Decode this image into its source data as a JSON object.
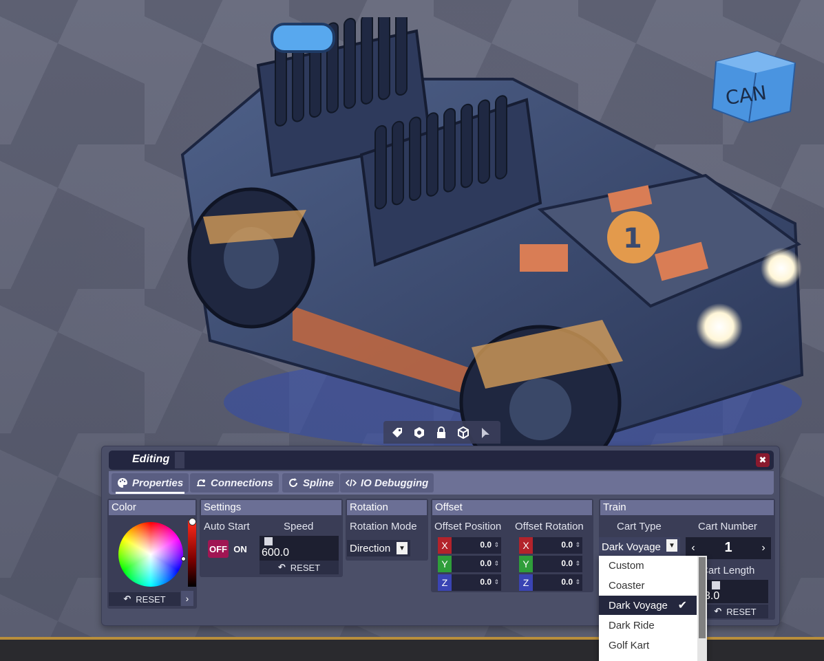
{
  "window": {
    "title": "Editing",
    "close_icon": "close-icon"
  },
  "gizmo_toolbar": {
    "icons": [
      "tag-icon",
      "box-gear-icon",
      "lock-icon",
      "cube-icon",
      "cursor-icon"
    ]
  },
  "tabs": [
    {
      "label": "Properties",
      "icon": "palette-icon",
      "active": true
    },
    {
      "label": "Connections",
      "icon": "connections-icon",
      "active": false
    },
    {
      "label": "Spline",
      "icon": "refresh-icon",
      "active": false
    },
    {
      "label": "IO Debugging",
      "icon": "code-icon",
      "active": false
    }
  ],
  "color_panel": {
    "title": "Color",
    "reset_label": "RESET"
  },
  "settings_panel": {
    "title": "Settings",
    "auto_start_label": "Auto Start",
    "off_label": "OFF",
    "on_label": "ON",
    "speed_label": "Speed",
    "speed_value": "600.0",
    "reset_label": "RESET"
  },
  "rotation_panel": {
    "title": "Rotation",
    "mode_label": "Rotation Mode",
    "mode_value": "Direction"
  },
  "offset_panel": {
    "title": "Offset",
    "position_label": "Offset Position",
    "rotation_label": "Offset Rotation",
    "position": {
      "x": "0.0",
      "y": "0.0",
      "z": "0.0"
    },
    "rotation": {
      "x": "0.0",
      "y": "0.0",
      "z": "0.0"
    },
    "axis_labels": {
      "x": "X",
      "y": "Y",
      "z": "Z"
    }
  },
  "train_panel": {
    "title": "Train",
    "cart_type_label": "Cart Type",
    "cart_type_value": "Dark Voyage",
    "cart_number_label": "Cart Number",
    "cart_number_value": "1",
    "cart_length_label": "Cart Length",
    "cart_length_value": "3.0",
    "reset_label": "RESET"
  },
  "cart_type_dropdown": {
    "options": [
      "Custom",
      "Coaster",
      "Dark Voyage",
      "Dark Ride",
      "Golf Kart"
    ],
    "selected": "Dark Voyage"
  },
  "scene": {
    "crate_text": "CAN",
    "cart_badge": "1"
  },
  "colors": {
    "accent": "#a01653",
    "panel": "#3a3d56",
    "header": "#6b6f95",
    "floor_line": "#b88e3c"
  }
}
